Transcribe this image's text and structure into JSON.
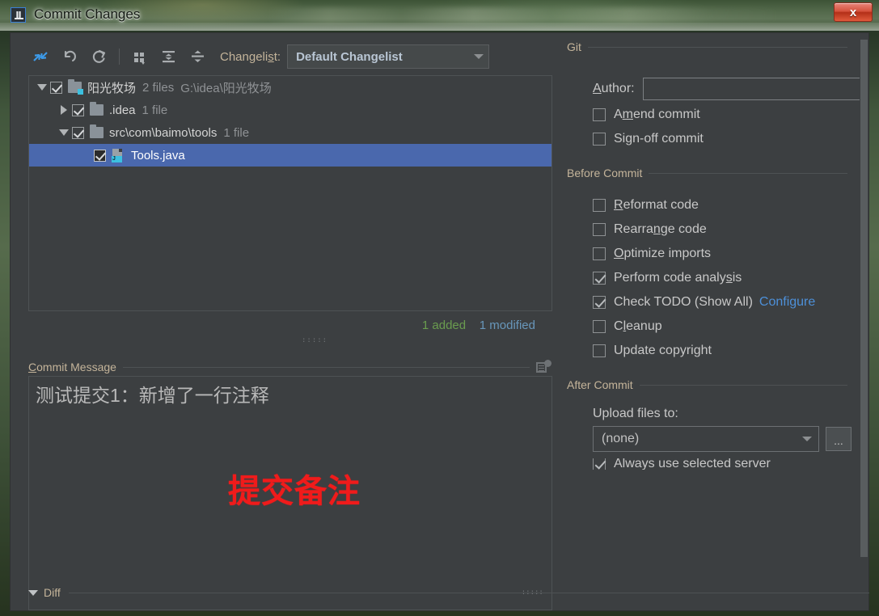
{
  "window": {
    "title": "Commit Changes",
    "app_icon": "intellij-idea-icon",
    "close_label": "x"
  },
  "toolbar": {
    "buttons": [
      {
        "name": "show-diff-icon",
        "label": ""
      },
      {
        "name": "revert-icon",
        "label": ""
      },
      {
        "name": "refresh-icon",
        "label": ""
      },
      {
        "name": "group-by-icon",
        "label": ""
      },
      {
        "name": "expand-all-icon",
        "label": ""
      },
      {
        "name": "collapse-all-icon",
        "label": ""
      }
    ],
    "changelist_label_pre": "Changeli",
    "changelist_label_accel": "s",
    "changelist_label_post": "t:",
    "changelist_value": "Default Changelist"
  },
  "tree": {
    "rows": [
      {
        "twisty": "down",
        "checked": true,
        "icon": "folder-vcs-icon",
        "name": "阳光牧场",
        "files": "2 files",
        "path": "G:\\idea\\阳光牧场",
        "indent": 0,
        "selected": false
      },
      {
        "twisty": "right",
        "checked": true,
        "icon": "folder-icon",
        "name": ".idea",
        "files": "1 file",
        "path": "",
        "indent": 1,
        "selected": false
      },
      {
        "twisty": "down",
        "checked": true,
        "icon": "folder-icon",
        "name": "src\\com\\baimo\\tools",
        "files": "1 file",
        "path": "",
        "indent": 1,
        "selected": false
      },
      {
        "twisty": "none",
        "checked": true,
        "icon": "java-file-icon",
        "name": "Tools.java",
        "files": "",
        "path": "",
        "indent": 2,
        "selected": true
      }
    ]
  },
  "counts": {
    "added": "1 added",
    "modified": "1 modified",
    "added_color": "#6a9c4f",
    "modified_color": "#6897bb"
  },
  "commit_message": {
    "header_accel": "C",
    "header_rest": "ommit Message",
    "value": "测试提交1：新增了一行注释",
    "history_icon": "message-history-icon"
  },
  "annotation": {
    "text": "提交备注",
    "color": "#f01b1b"
  },
  "diff": {
    "title": "Diff",
    "expanded": true
  },
  "right_panel": {
    "git": {
      "title": "Git",
      "author_accel": "A",
      "author_rest": "uthor:",
      "author_value": "",
      "options": [
        {
          "name": "amend-commit",
          "pre": "A",
          "accel": "m",
          "post": "end commit",
          "checked": false
        },
        {
          "name": "sign-off-commit",
          "pre": "Sign-off commit",
          "accel": "",
          "post": "",
          "checked": false
        }
      ]
    },
    "before_commit": {
      "title": "Before Commit",
      "options": [
        {
          "name": "reformat-code",
          "pre": "",
          "accel": "R",
          "post": "eformat code",
          "checked": false,
          "link": ""
        },
        {
          "name": "rearrange-code",
          "pre": "Rearra",
          "accel": "n",
          "post": "ge code",
          "checked": false,
          "link": ""
        },
        {
          "name": "optimize-imports",
          "pre": "",
          "accel": "O",
          "post": "ptimize imports",
          "checked": false,
          "link": ""
        },
        {
          "name": "perform-code-analysis",
          "pre": "Perform code analy",
          "accel": "s",
          "post": "is",
          "checked": true,
          "link": ""
        },
        {
          "name": "check-todo",
          "pre": "Check TODO (Show All)",
          "accel": "",
          "post": "",
          "checked": true,
          "link": "Configure"
        },
        {
          "name": "cleanup",
          "pre": "C",
          "accel": "l",
          "post": "eanup",
          "checked": false,
          "link": ""
        },
        {
          "name": "update-copyright",
          "pre": "Update copyright",
          "accel": "",
          "post": "",
          "checked": false,
          "link": ""
        }
      ]
    },
    "after_commit": {
      "title": "After Commit",
      "upload_label": "Upload files to:",
      "upload_value": "(none)",
      "browse_label": "...",
      "always_use_server": {
        "label": "Always use selected server",
        "checked": true
      }
    }
  }
}
